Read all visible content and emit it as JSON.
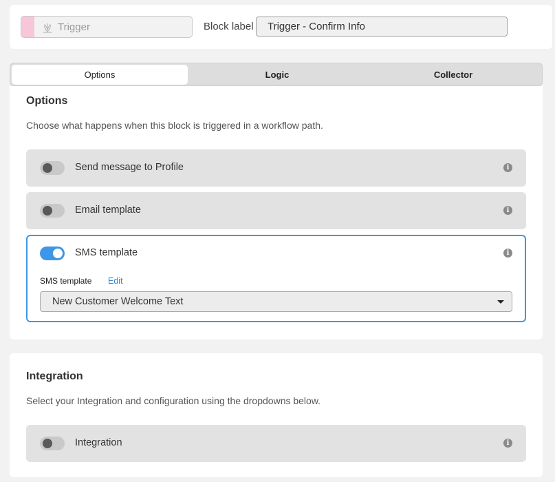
{
  "header": {
    "trigger_label": "Trigger",
    "trigger_accent_color": "#f7c6d8",
    "block_label": "Block label",
    "block_label_value": "Trigger - Confirm Info"
  },
  "tabs": [
    {
      "label": "Options",
      "active": true
    },
    {
      "label": "Logic",
      "active": false
    },
    {
      "label": "Collector",
      "active": false
    }
  ],
  "options": {
    "title": "Options",
    "description": "Choose what happens when this block is triggered in a workflow path.",
    "rows": [
      {
        "label": "Send message to Profile",
        "enabled": false,
        "icon": "info-icon"
      },
      {
        "label": "Email template",
        "enabled": false,
        "icon": "info-icon"
      },
      {
        "label": "SMS template",
        "enabled": true,
        "icon": "info-icon"
      }
    ],
    "sms": {
      "field_label": "SMS template",
      "edit_label": "Edit",
      "selected": "New Customer Welcome Text"
    }
  },
  "integration": {
    "title": "Integration",
    "description": "Select your Integration and configuration using the dropdowns below.",
    "row_label": "Integration",
    "enabled": false
  },
  "colors": {
    "accent": "#3d96e8",
    "link": "#2f86d8"
  }
}
